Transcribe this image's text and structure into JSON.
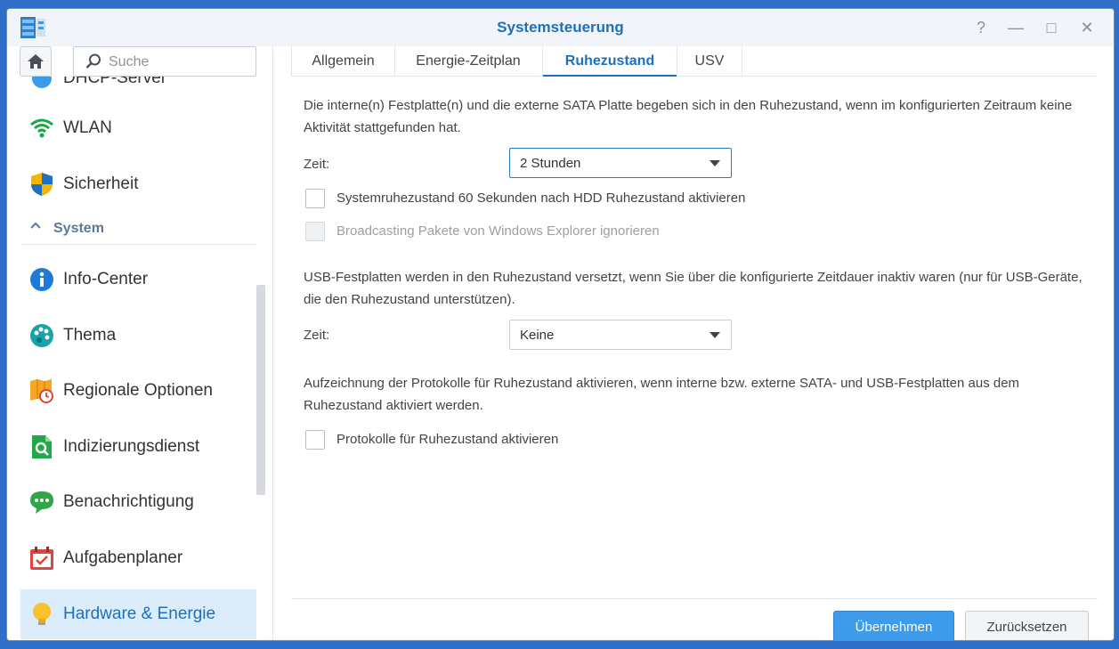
{
  "window": {
    "title": "Systemsteuerung"
  },
  "window_controls": {
    "help": "?",
    "minimize": "—",
    "maximize": "□",
    "close": "✕"
  },
  "search": {
    "placeholder": "Suche"
  },
  "sidebar": {
    "partial_item": "DHCP-Server",
    "items_top": [
      {
        "label": "WLAN",
        "icon": "wifi-icon"
      },
      {
        "label": "Sicherheit",
        "icon": "shield-icon"
      }
    ],
    "group": {
      "label": "System"
    },
    "items": [
      {
        "label": "Info-Center",
        "icon": "info-icon"
      },
      {
        "label": "Thema",
        "icon": "palette-icon"
      },
      {
        "label": "Regionale Optionen",
        "icon": "map-clock-icon"
      },
      {
        "label": "Indizierungsdienst",
        "icon": "index-search-icon"
      },
      {
        "label": "Benachrichtigung",
        "icon": "chat-bubble-icon"
      },
      {
        "label": "Aufgabenplaner",
        "icon": "calendar-check-icon"
      },
      {
        "label": "Hardware & Energie",
        "icon": "lightbulb-icon",
        "active": true
      }
    ]
  },
  "tabs": [
    {
      "label": "Allgemein"
    },
    {
      "label": "Energie-Zeitplan"
    },
    {
      "label": "Ruhezustand",
      "active": true
    },
    {
      "label": "USV"
    }
  ],
  "section1": {
    "text": "Die interne(n) Festplatte(n) und die externe SATA Platte begeben sich in den Ruhezustand, wenn im konfigurierten Zeitraum keine Aktivität stattgefunden hat.",
    "zeit_label": "Zeit:",
    "zeit_value": "2 Stunden",
    "checkbox1": {
      "label": "Systemruhezustand 60 Sekunden nach HDD Ruhezustand aktivieren",
      "checked": false
    },
    "checkbox2": {
      "label": "Broadcasting Pakete von Windows Explorer ignorieren",
      "checked": false,
      "disabled": true
    }
  },
  "section2": {
    "text": "USB-Festplatten werden in den Ruhezustand versetzt, wenn Sie über die konfigurierte Zeitdauer inaktiv waren (nur für USB-Geräte, die den Ruhezustand unterstützen).",
    "zeit_label": "Zeit:",
    "zeit_value": "Keine"
  },
  "section3": {
    "text": "Aufzeichnung der Protokolle für Ruhezustand aktivieren, wenn interne bzw. externe SATA- und USB-Festplatten aus dem Ruhezustand aktiviert werden.",
    "checkbox": {
      "label": "Protokolle für Ruhezustand aktivieren",
      "checked": false
    }
  },
  "footer": {
    "apply": "Übernehmen",
    "reset": "Zurücksetzen"
  },
  "colors": {
    "accent": "#1e6fbd",
    "primary_button": "#3d9be9",
    "active_item_bg": "#dbecfb"
  }
}
